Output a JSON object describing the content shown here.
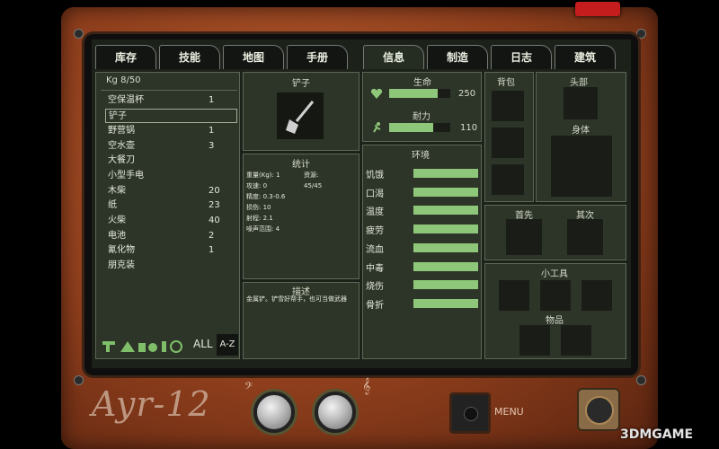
{
  "tabs_left": [
    "库存",
    "技能",
    "地图",
    "手册"
  ],
  "tabs_right": [
    "信息",
    "制造",
    "日志",
    "建筑"
  ],
  "inventory": {
    "weight": "Kg 8/50",
    "items": [
      {
        "name": "空保温杯",
        "count": "1"
      },
      {
        "name": "铲子",
        "count": ""
      },
      {
        "name": "野营锅",
        "count": "1"
      },
      {
        "name": "空水壶",
        "count": "3"
      },
      {
        "name": "大餐刀",
        "count": ""
      },
      {
        "name": "小型手电",
        "count": ""
      },
      {
        "name": "木柴",
        "count": "20"
      },
      {
        "name": "纸",
        "count": "23"
      },
      {
        "name": "火柴",
        "count": "40"
      },
      {
        "name": "电池",
        "count": "2"
      },
      {
        "name": "氰化物",
        "count": "1"
      },
      {
        "name": "朋克装",
        "count": ""
      }
    ],
    "filter_all": "ALL",
    "sort_az": "A-Z"
  },
  "item_detail": {
    "name": "铲子",
    "stats_title": "统计",
    "stats": [
      "重量(Kg): 1",
      "资源: 45/45",
      "攻速: 0",
      "精度: 0.3-0.6",
      "损伤: 10",
      "射程: 2.1",
      "噪声范围: 4"
    ],
    "desc_title": "描述",
    "description": "金属铲。铲雪好帮手，也可当做武器"
  },
  "vitals": {
    "health_label": "生命",
    "health_value": "250",
    "health_fill": 0.8,
    "stamina_label": "耐力",
    "stamina_value": "110",
    "stamina_fill": 0.72
  },
  "environment": {
    "title": "环境",
    "conditions": [
      {
        "label": "饥饿",
        "fill": 1
      },
      {
        "label": "口渴",
        "fill": 1
      },
      {
        "label": "温度",
        "fill": 1
      },
      {
        "label": "疲劳",
        "fill": 1
      },
      {
        "label": "流血",
        "fill": 1
      },
      {
        "label": "中毒",
        "fill": 1
      },
      {
        "label": "烧伤",
        "fill": 1
      },
      {
        "label": "骨折",
        "fill": 1
      }
    ]
  },
  "equipment": {
    "backpack": "背包",
    "head": "头部",
    "body": "身体",
    "primary": "首先",
    "secondary": "其次",
    "gadgets": "小工具",
    "items": "物品"
  },
  "device": {
    "brand": "Ayr-12",
    "menu": "MENU",
    "watermark": "3DMGAME"
  },
  "colors": {
    "bar": "#8fc77a",
    "screen": "#1c2219",
    "panel": "#2d3529",
    "casing": "#8e3e1c"
  }
}
